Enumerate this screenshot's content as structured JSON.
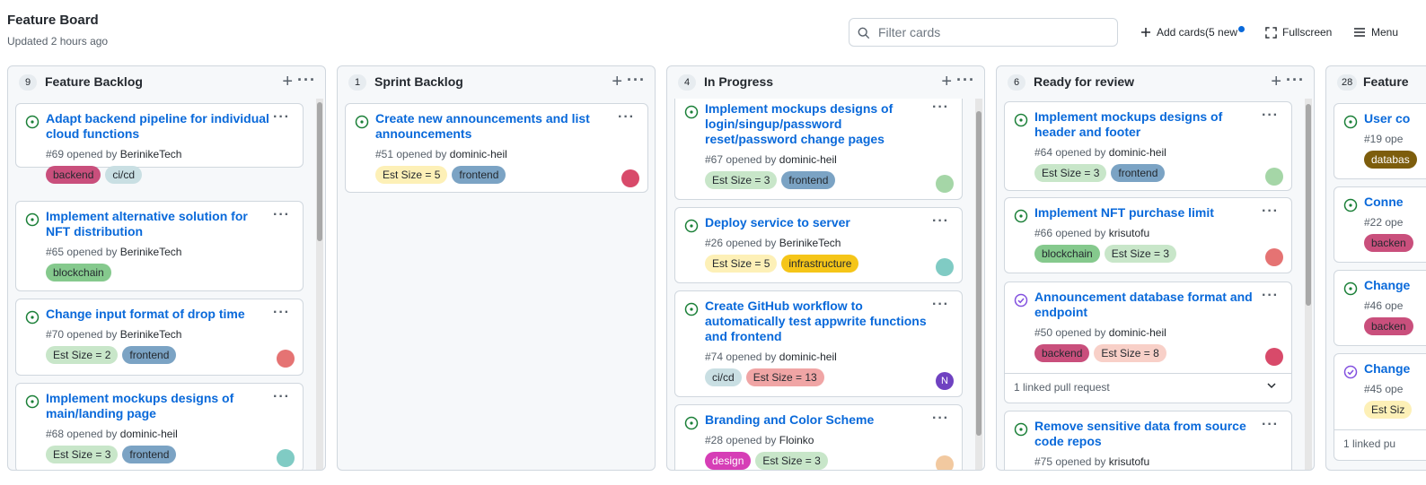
{
  "header": {
    "title": "Feature Board",
    "updated": "Updated 2 hours ago",
    "filter_placeholder": "Filter cards",
    "add_cards": "Add cards(5 new",
    "fullscreen": "Fullscreen",
    "menu": "Menu",
    "new_dot_color": "#0969da"
  },
  "columns": [
    {
      "name": "Feature Backlog",
      "count": "9",
      "cards": [
        {
          "title": "Adapt backend pipeline for individual cloud functions",
          "number": "#69",
          "opened_by": "opened by",
          "author": "BerinikeTech",
          "status": "open",
          "labels": [
            {
              "text": "backend",
              "color": "#c94f7c"
            },
            {
              "text": "ci/cd",
              "color": "#c9dfe3"
            }
          ]
        },
        {
          "title": "Implement alternative solution for NFT distribution",
          "number": "#65",
          "opened_by": "opened by",
          "author": "BerinikeTech",
          "status": "open",
          "labels": [
            {
              "text": "blockchain",
              "color": "#85c98d"
            }
          ]
        },
        {
          "title": "Change input format of drop time",
          "number": "#70",
          "opened_by": "opened by",
          "author": "BerinikeTech",
          "status": "open",
          "labels": [
            {
              "text": "Est Size = 2",
              "color": "#c8e6c9"
            },
            {
              "text": "frontend",
              "color": "#7ba3c4"
            }
          ],
          "avatar": "#e57373"
        },
        {
          "title": "Implement mockups designs of main/landing page",
          "number": "#68",
          "opened_by": "opened by",
          "author": "dominic-heil",
          "status": "open",
          "labels": [
            {
              "text": "Est Size = 3",
              "color": "#c8e6c9"
            },
            {
              "text": "frontend",
              "color": "#7ba3c4"
            }
          ],
          "avatar": "#80cbc4"
        }
      ]
    },
    {
      "name": "Sprint Backlog",
      "count": "1",
      "cards": [
        {
          "title": "Create new announcements and list announcements",
          "number": "#51",
          "opened_by": "opened by",
          "author": "dominic-heil",
          "status": "open",
          "labels": [
            {
              "text": "Est Size = 5",
              "color": "#fdf0b7"
            },
            {
              "text": "frontend",
              "color": "#7ba3c4"
            }
          ],
          "avatar": "#d84a6a"
        }
      ]
    },
    {
      "name": "In Progress",
      "count": "4",
      "cards": [
        {
          "title": "Implement mockups designs of login/singup/password reset/password change pages",
          "number": "#67",
          "opened_by": "opened by",
          "author": "dominic-heil",
          "status": "open",
          "labels": [
            {
              "text": "Est Size = 3",
              "color": "#c8e6c9"
            },
            {
              "text": "frontend",
              "color": "#7ba3c4"
            }
          ],
          "avatar": "#a5d6a7"
        },
        {
          "title": "Deploy service to server",
          "number": "#26",
          "opened_by": "opened by",
          "author": "BerinikeTech",
          "status": "open",
          "labels": [
            {
              "text": "Est Size = 5",
              "color": "#fdf0b7"
            },
            {
              "text": "infrastructure",
              "color": "#f5c518"
            }
          ],
          "avatar": "#80cbc4"
        },
        {
          "title": "Create GitHub workflow to automatically test appwrite functions and frontend",
          "number": "#74",
          "opened_by": "opened by",
          "author": "dominic-heil",
          "status": "open",
          "labels": [
            {
              "text": "ci/cd",
              "color": "#c9dfe3"
            },
            {
              "text": "Est Size = 13",
              "color": "#f0a5a5"
            }
          ],
          "avatar": "#6f42c1",
          "avatar_letter": "N"
        },
        {
          "title": "Branding and Color Scheme",
          "number": "#28",
          "opened_by": "opened by",
          "author": "Floinko",
          "status": "open",
          "labels": [
            {
              "text": "design",
              "color": "#d63eb6"
            },
            {
              "text": "Est Size = 3",
              "color": "#c8e6c9"
            }
          ],
          "avatar": "#f2c9a0"
        }
      ]
    },
    {
      "name": "Ready for review",
      "count": "6",
      "cards": [
        {
          "title": "Implement mockups designs of header and footer",
          "number": "#64",
          "opened_by": "opened by",
          "author": "dominic-heil",
          "status": "open",
          "labels": [
            {
              "text": "Est Size = 3",
              "color": "#c8e6c9"
            },
            {
              "text": "frontend",
              "color": "#7ba3c4"
            }
          ],
          "avatar": "#a5d6a7"
        },
        {
          "title": "Implement NFT purchase limit",
          "number": "#66",
          "opened_by": "opened by",
          "author": "krisutofu",
          "status": "open",
          "labels": [
            {
              "text": "blockchain",
              "color": "#85c98d"
            },
            {
              "text": "Est Size = 3",
              "color": "#c8e6c9"
            }
          ],
          "avatar": "#e57373"
        },
        {
          "title": "Announcement database format and endpoint",
          "number": "#50",
          "opened_by": "opened by",
          "author": "dominic-heil",
          "status": "closed",
          "labels": [
            {
              "text": "backend",
              "color": "#c94f7c"
            },
            {
              "text": "Est Size = 8",
              "color": "#f8d0c8"
            }
          ],
          "avatar": "#d84a6a",
          "linked": "1 linked pull request"
        },
        {
          "title": "Remove sensitive data from source code repos",
          "number": "#75",
          "opened_by": "opened by",
          "author": "krisutofu",
          "status": "open",
          "labels": []
        }
      ]
    },
    {
      "name": "Feature",
      "count": "28",
      "cards": [
        {
          "title": "User co",
          "number": "#19",
          "opened_by": "ope",
          "author": "",
          "status": "open",
          "labels": [
            {
              "text": "databas",
              "color": "#7d5d0c"
            }
          ]
        },
        {
          "title": "Conne",
          "number": "#22",
          "opened_by": "ope",
          "author": "",
          "status": "open",
          "labels": [
            {
              "text": "backen",
              "color": "#c94f7c"
            }
          ]
        },
        {
          "title": "Change",
          "number": "#46",
          "opened_by": "ope",
          "author": "",
          "status": "open",
          "labels": [
            {
              "text": "backen",
              "color": "#c94f7c"
            }
          ]
        },
        {
          "title": "Change",
          "number": "#45",
          "opened_by": "ope",
          "author": "",
          "status": "closed",
          "labels": [
            {
              "text": "Est Siz",
              "color": "#fdf0b7"
            }
          ],
          "linked": "1 linked pu"
        }
      ]
    }
  ]
}
